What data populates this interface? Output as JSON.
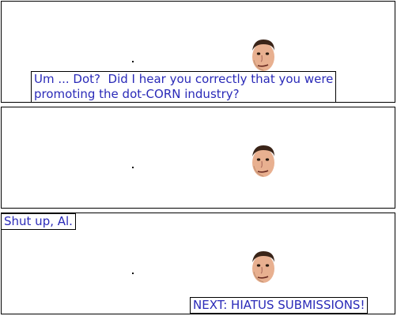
{
  "panels": [
    {
      "caption": "Um ... Dot?  Did I hear you correctly that you were\npromoting the dot-CORN industry?"
    },
    {
      "caption": ""
    },
    {
      "caption": "Shut up, Al."
    }
  ],
  "footer": {
    "text": "NEXT: HIATUS SUBMISSIONS!"
  },
  "colors": {
    "caption_text": "#2a2ab8",
    "border": "#000000"
  },
  "icons": {
    "speaker": "al-face-icon",
    "listener": "dot-icon"
  }
}
